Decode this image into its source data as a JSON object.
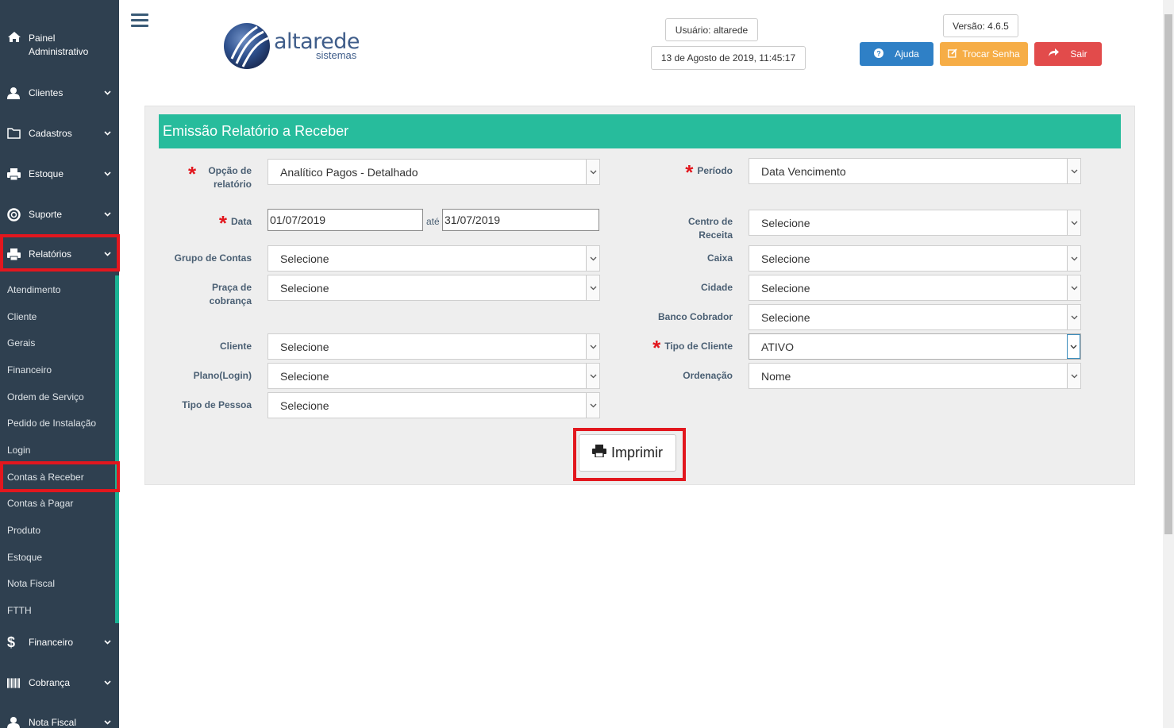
{
  "sidebar": {
    "admin_label": "Painel Administrativo",
    "items": [
      {
        "label": "Clientes",
        "icon": "user-icon"
      },
      {
        "label": "Cadastros",
        "icon": "folder-icon"
      },
      {
        "label": "Estoque",
        "icon": "print-icon"
      },
      {
        "label": "Suporte",
        "icon": "lifebuoy-icon"
      },
      {
        "label": "Relatórios",
        "icon": "print-icon"
      },
      {
        "label": "Financeiro",
        "icon": "dollar-icon"
      },
      {
        "label": "Cobrança",
        "icon": "barcode-icon"
      },
      {
        "label": "Nota Fiscal",
        "icon": "user-icon"
      }
    ],
    "submenu": [
      "Atendimento",
      "Cliente",
      "Gerais",
      "Financeiro",
      "Ordem de Serviço",
      "Pedido de Instalação",
      "Login",
      "Contas à Receber",
      "Contas à Pagar",
      "Produto",
      "Estoque",
      "Nota Fiscal",
      "FTTH"
    ],
    "active_submenu": "Contas à Receber"
  },
  "header": {
    "logo_text": "altarede",
    "logo_sub": "sistemas",
    "user": "Usuário: altarede",
    "datetime": "13 de Agosto de 2019, 11:45:17",
    "version": "Versão: 4.6.5",
    "help_label": "Ajuda",
    "change_pass_label": "Trocar Senha",
    "exit_label": "Sair"
  },
  "form": {
    "title": "Emissão Relatório a Receber",
    "opcao_label": "Opção de relatório",
    "opcao_value": "Analítico Pagos - Detalhado",
    "periodo_label": "Período",
    "periodo_value": "Data Vencimento",
    "data_label": "Data",
    "data_from": "01/07/2019",
    "ate": "até",
    "data_to": "31/07/2019",
    "centro_label": "Centro de Receita",
    "centro_value": "Selecione",
    "grupo_label": "Grupo de Contas",
    "grupo_value": "Selecione",
    "caixa_label": "Caixa",
    "caixa_value": "Selecione",
    "praca_label": "Praça de cobrança",
    "praca_value": "Selecione",
    "cidade_label": "Cidade",
    "cidade_value": "Selecione",
    "banco_label": "Banco Cobrador",
    "banco_value": "Selecione",
    "cliente_label": "Cliente",
    "cliente_value": "Selecione",
    "tipo_cliente_label": "Tipo de Cliente",
    "tipo_cliente_value": "ATIVO",
    "plano_label": "Plano(Login)",
    "plano_value": "Selecione",
    "ordenacao_label": "Ordenação",
    "ordenacao_value": "Nome",
    "tipo_pessoa_label": "Tipo de Pessoa",
    "tipo_pessoa_value": "Selecione",
    "print_label": "Imprimir"
  },
  "colors": {
    "sidebar_bg": "#2f4050",
    "accent_green": "#27bc9c",
    "help_blue": "#2f80c6",
    "change_orange": "#f6ad46",
    "exit_red": "#e24b4b",
    "highlight_red": "#e2171e"
  }
}
